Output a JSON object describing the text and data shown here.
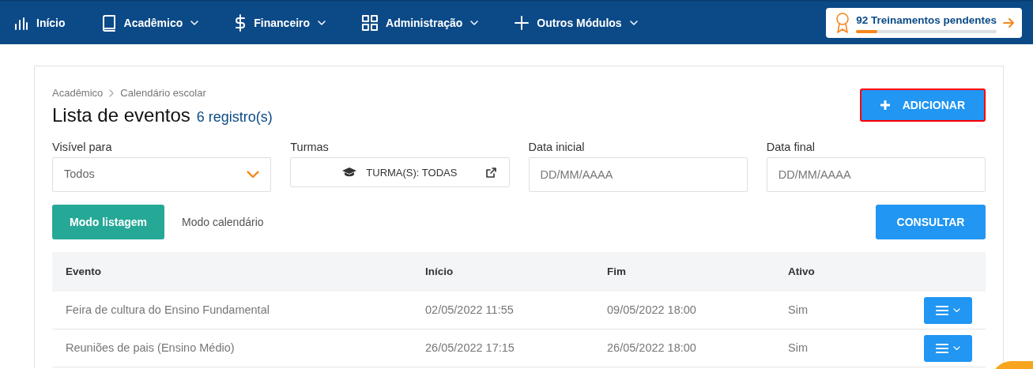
{
  "nav": {
    "items": [
      {
        "label": "Início",
        "dropdown": false
      },
      {
        "label": "Acadêmico",
        "dropdown": true
      },
      {
        "label": "Financeiro",
        "dropdown": true
      },
      {
        "label": "Administração",
        "dropdown": true
      },
      {
        "label": "Outros Módulos",
        "dropdown": true
      }
    ],
    "training": {
      "label": "92 Treinamentos pendentes",
      "level": 0.15
    }
  },
  "breadcrumb": [
    "Acadêmico",
    "Calendário escolar"
  ],
  "title": "Lista de eventos",
  "count": "6 registro(s)",
  "add_button": {
    "label": "ADICIONAR",
    "highlighted": true
  },
  "filters": [
    {
      "kind": "select",
      "label": "Visível para",
      "value": "Todos"
    },
    {
      "kind": "picker",
      "label": "Turmas",
      "value": "TURMA(S): TODAS"
    },
    {
      "kind": "date",
      "label": "Data inicial",
      "placeholder": "DD/MM/AAAA"
    },
    {
      "kind": "date",
      "label": "Data final",
      "placeholder": "DD/MM/AAAA"
    }
  ],
  "modes": [
    {
      "label": "Modo listagem",
      "selected": true
    },
    {
      "label": "Modo calendário",
      "selected": false
    }
  ],
  "search_button": "CONSULTAR",
  "table": {
    "columns": [
      "Evento",
      "Início",
      "Fim",
      "Ativo"
    ],
    "rows": [
      {
        "cells": [
          "Feira de cultura do Ensino Fundamental",
          "02/05/2022 11:55",
          "09/05/2022 18:00",
          "Sim"
        ]
      },
      {
        "cells": [
          "Reuniões de pais (Ensino Médio)",
          "26/05/2022 17:15",
          "26/05/2022 18:00",
          "Sim"
        ]
      }
    ]
  }
}
